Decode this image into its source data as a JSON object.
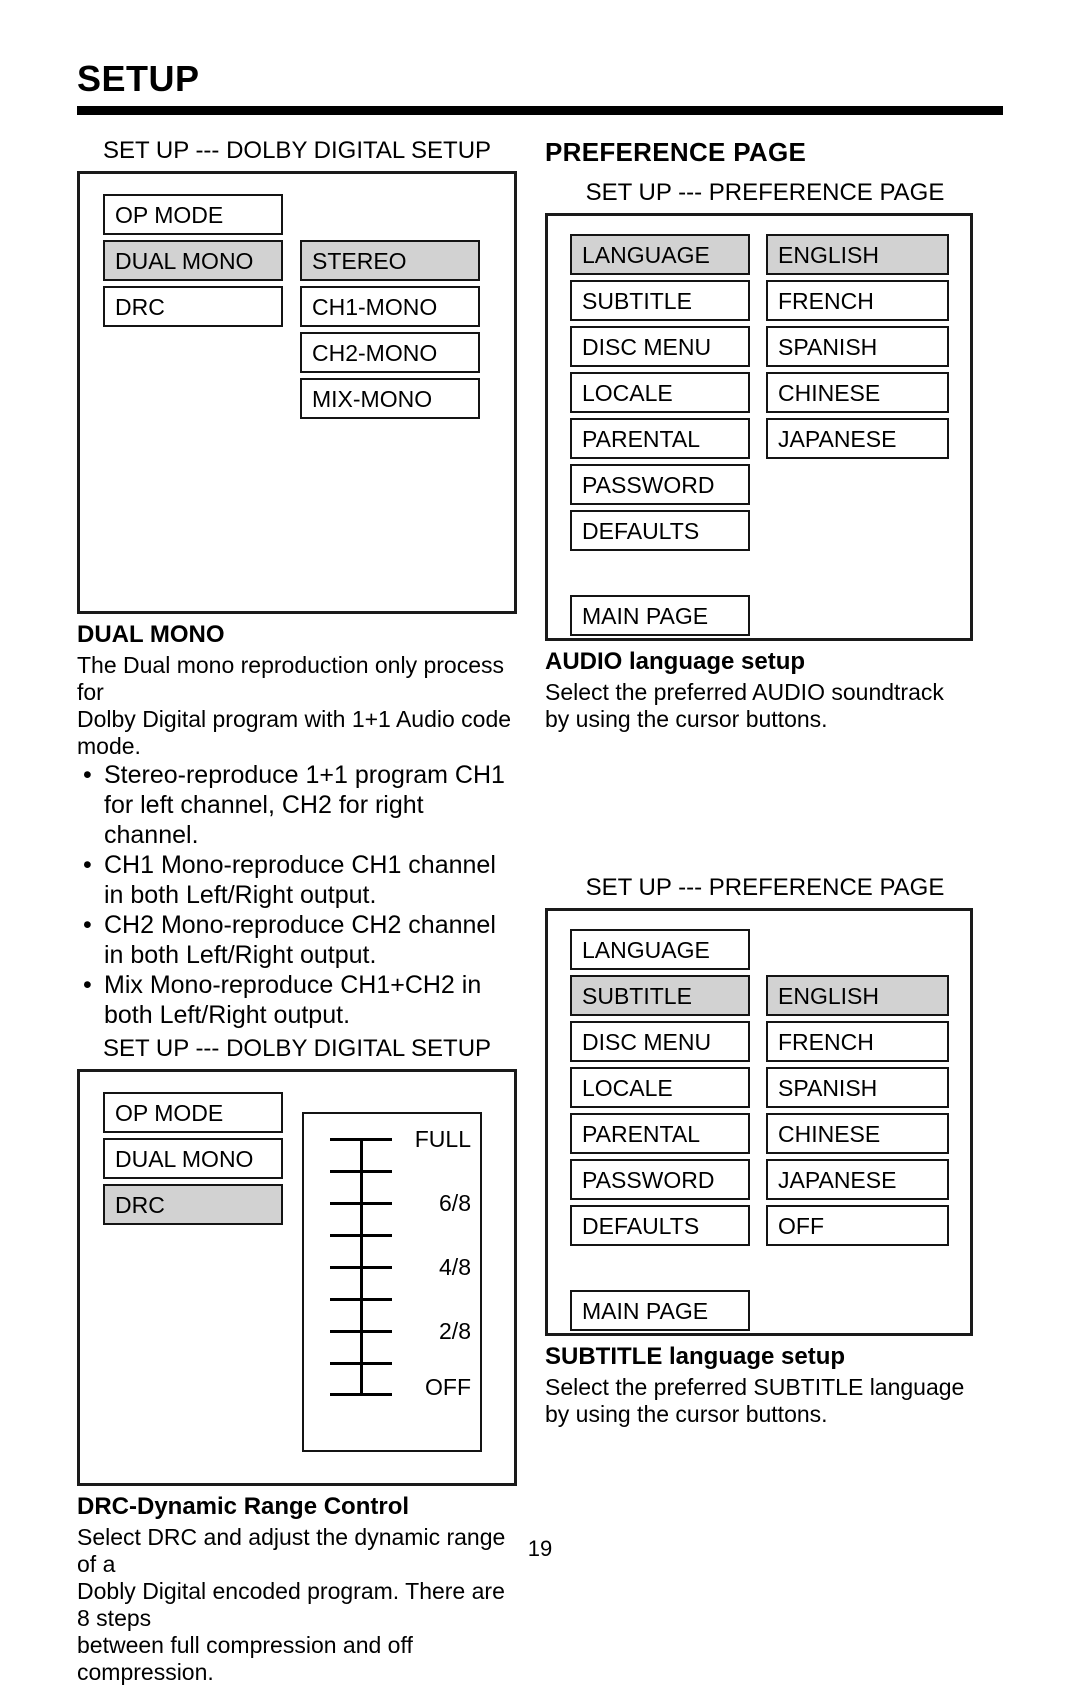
{
  "header": {
    "title": "SETUP"
  },
  "left_column": {
    "dolby_dualmono_diagram": {
      "caption": "SET UP --- DOLBY DIGITAL SETUP",
      "left_menu": [
        {
          "label": "OP MODE",
          "selected": false
        },
        {
          "label": "DUAL MONO",
          "selected": true
        },
        {
          "label": "DRC",
          "selected": false
        }
      ],
      "right_menu": [
        {
          "label": "STEREO",
          "selected": true
        },
        {
          "label": "CH1-MONO",
          "selected": false
        },
        {
          "label": "CH2-MONO",
          "selected": false
        },
        {
          "label": "MIX-MONO",
          "selected": false
        }
      ]
    },
    "dualmono_text": {
      "heading": "DUAL MONO",
      "intro_line1": "The Dual mono reproduction only process for",
      "intro_line2": "Dolby Digital program with 1+1 Audio code mode.",
      "bullets": [
        "Stereo-reproduce 1+1 program CH1 for left channel, CH2 for right channel.",
        "CH1 Mono-reproduce CH1 channel in both Left/Right output.",
        "CH2 Mono-reproduce CH2 channel in both Left/Right output.",
        "Mix Mono-reproduce CH1+CH2 in both Left/Right output."
      ]
    },
    "dolby_drc_diagram": {
      "caption": "SET UP --- DOLBY DIGITAL SETUP",
      "left_menu": [
        {
          "label": "OP MODE",
          "selected": false
        },
        {
          "label": "DUAL MONO",
          "selected": false
        },
        {
          "label": "DRC",
          "selected": true
        }
      ],
      "slider": {
        "tick_count": 9,
        "labels": [
          "FULL",
          "6/8",
          "4/8",
          "2/8",
          "OFF"
        ]
      }
    },
    "drc_text": {
      "heading": "DRC-Dynamic Range Control",
      "line1": "Select DRC and adjust the dynamic range of a",
      "line2": "Dobly Digital encoded program.  There are 8 steps",
      "line3": "between full compression and off compression."
    }
  },
  "right_column": {
    "section_heading": "PREFERENCE PAGE",
    "pref_audio_diagram": {
      "caption": "SET UP --- PREFERENCE PAGE",
      "left_menu": [
        {
          "label": "LANGUAGE",
          "selected": true
        },
        {
          "label": "SUBTITLE",
          "selected": false
        },
        {
          "label": "DISC MENU",
          "selected": false
        },
        {
          "label": "LOCALE",
          "selected": false
        },
        {
          "label": "PARENTAL",
          "selected": false
        },
        {
          "label": "PASSWORD",
          "selected": false
        },
        {
          "label": "DEFAULTS",
          "selected": false
        }
      ],
      "main_page_label": "MAIN PAGE",
      "right_menu": [
        {
          "label": "ENGLISH",
          "selected": true
        },
        {
          "label": "FRENCH",
          "selected": false
        },
        {
          "label": "SPANISH",
          "selected": false
        },
        {
          "label": "CHINESE",
          "selected": false
        },
        {
          "label": "JAPANESE",
          "selected": false
        }
      ]
    },
    "audio_text": {
      "heading": "AUDIO language setup",
      "line1": "Select the preferred AUDIO soundtrack",
      "line2": "by using the cursor buttons."
    },
    "pref_subtitle_diagram": {
      "caption": "SET UP --- PREFERENCE PAGE",
      "left_menu": [
        {
          "label": "LANGUAGE",
          "selected": false
        },
        {
          "label": "SUBTITLE",
          "selected": true
        },
        {
          "label": "DISC MENU",
          "selected": false
        },
        {
          "label": "LOCALE",
          "selected": false
        },
        {
          "label": "PARENTAL",
          "selected": false
        },
        {
          "label": "PASSWORD",
          "selected": false
        },
        {
          "label": "DEFAULTS",
          "selected": false
        }
      ],
      "main_page_label": "MAIN PAGE",
      "right_menu": [
        {
          "label": "ENGLISH",
          "selected": true
        },
        {
          "label": "FRENCH",
          "selected": false
        },
        {
          "label": "SPANISH",
          "selected": false
        },
        {
          "label": "CHINESE",
          "selected": false
        },
        {
          "label": "JAPANESE",
          "selected": false
        },
        {
          "label": "OFF",
          "selected": false
        }
      ]
    },
    "subtitle_text": {
      "heading": "SUBTITLE language setup",
      "line1": "Select the preferred SUBTITLE language",
      "line2": "by using the cursor buttons."
    }
  },
  "footer": {
    "page_number": "19"
  },
  "colors": {
    "highlight": "#d2d2d2",
    "line": "#141414",
    "text": "#000000"
  }
}
